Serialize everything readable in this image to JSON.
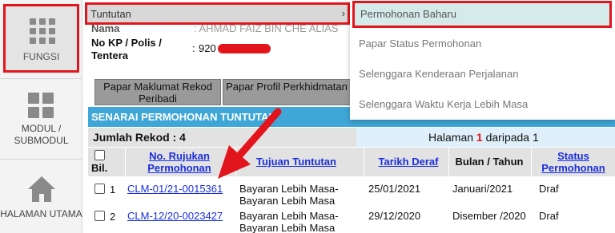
{
  "sidebar": {
    "items": [
      {
        "label": "FUNGSI",
        "icon": "grid-icon",
        "active": true
      },
      {
        "label": "MODUL / SUBMODUL",
        "icon": "grid-icon"
      },
      {
        "label": "HALAMAN UTAMA",
        "icon": "home-icon"
      }
    ]
  },
  "menu_bar": {
    "label": "Tuntutan",
    "chevron": "›"
  },
  "profile": {
    "name_label": "Nama",
    "name_value": ": AHMAD FAIZ BIN CHE ALIAS",
    "kp_label": "No KP / Polis / Tentera",
    "kp_colon": ":",
    "kp_value": "920"
  },
  "tabs": [
    {
      "label": "Papar Maklumat Rekod Peribadi"
    },
    {
      "label": "Papar Profil Perkhidmatan"
    }
  ],
  "section_title": "SENARAI PERMOHONAN TUNTUTAN",
  "record_count": "Jumlah Rekod : 4",
  "pager": {
    "prefix": "Halaman ",
    "current": "1",
    "mid": " daripada ",
    "total": "1"
  },
  "table": {
    "headers": {
      "bil": "Bil.",
      "rujukan": "No. Rujukan Permohonan",
      "tujuan": "Tujuan Tuntutan",
      "tarikh": "Tarikh Deraf",
      "bulan": "Bulan / Tahun",
      "status": "Status Permohonan"
    },
    "rows": [
      {
        "bil": "1",
        "rujukan": "CLM-01/21-0015361",
        "tujuan": "Bayaran Lebih Masa- Bayaran Lebih Masa",
        "tarikh": "25/01/2021",
        "bulan": "Januari/2021",
        "status": "Draf"
      },
      {
        "bil": "2",
        "rujukan": "CLM-12/20-0023427",
        "tujuan": "Bayaran Lebih Masa- Bayaran Lebih Masa",
        "tarikh": "29/12/2020",
        "bulan": "Disember /2020",
        "status": "Draf"
      }
    ]
  },
  "dropdown": {
    "items": [
      {
        "label": "Permohonan Baharu"
      },
      {
        "label": "Papar Status Permohonan"
      },
      {
        "label": "Selenggara Kenderaan Perjalanan"
      },
      {
        "label": "Selenggara Waktu Kerja Lebih Masa"
      }
    ]
  },
  "colors": {
    "highlight": "#e3151c",
    "header_blue": "#3fa6d8",
    "link": "#1a2ee0"
  }
}
